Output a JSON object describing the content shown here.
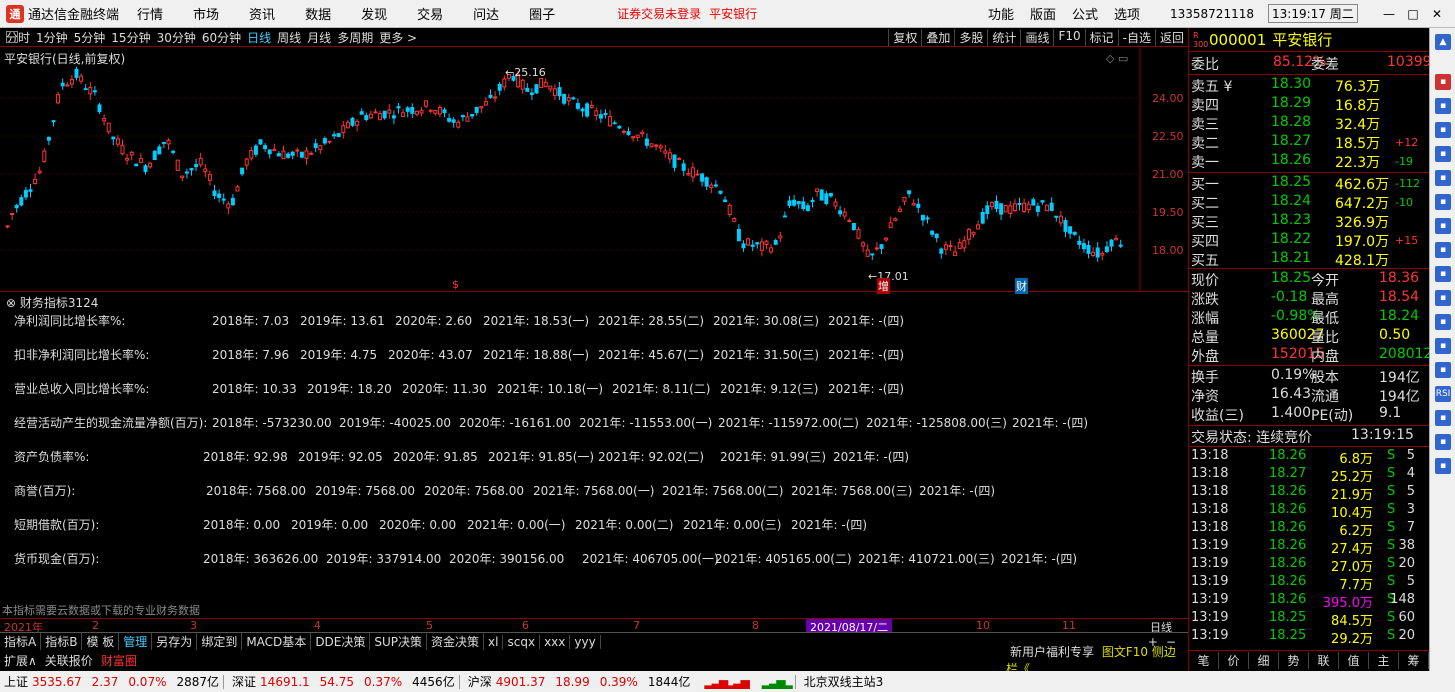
{
  "titlebar": {
    "app_name": "通达信金融终端",
    "menus": [
      "行情",
      "市场",
      "资讯",
      "数据",
      "发现",
      "交易",
      "问达",
      "圈子"
    ],
    "warning": "证券交易未登录",
    "stock_name": "平安银行",
    "right_menus": [
      "功能",
      "版面",
      "公式",
      "选项"
    ],
    "account": "13358721118",
    "clock": "13:19:17 周二",
    "win_buttons": [
      "—",
      "□",
      "✕"
    ]
  },
  "periodbar": {
    "periods": [
      "分时",
      "1分钟",
      "5分钟",
      "15分钟",
      "30分钟",
      "60分钟",
      "日线",
      "周线",
      "月线",
      "多周期",
      "更多 >"
    ],
    "active_index": 6,
    "tools": [
      "复权",
      "叠加",
      "多股",
      "统计",
      "画线",
      "F10",
      "标记",
      "-自选",
      "返回"
    ]
  },
  "chart": {
    "title": "平安银行(日线,前复权)",
    "high_label": "25.16",
    "low_label": "17.01",
    "markers": [
      "$",
      "增",
      "财"
    ],
    "y_ticks": [
      "24.00",
      "22.50",
      "21.00",
      "19.50",
      "18.00"
    ]
  },
  "chart_data": {
    "type": "candlestick",
    "y_ticks": [
      24.0,
      22.5,
      21.0,
      19.5,
      18.0
    ],
    "max": 25.16,
    "min": 17.01,
    "x_ticks": [
      "2021年",
      "2",
      "3",
      "4",
      "5",
      "6",
      "7",
      "8",
      "2021/08/17/二",
      "10",
      "11"
    ],
    "right_label": "日线"
  },
  "finance": {
    "title": "财务指标3124",
    "rows": [
      {
        "label": "净利润同比增长率%:",
        "values": [
          "2018年: 7.03",
          "2019年: 13.61",
          "2020年: 2.60",
          "2021年: 18.53(一)",
          "2021年: 28.55(二)",
          "2021年: 30.08(三)",
          "2021年: -(四)"
        ]
      },
      {
        "label": "扣非净利润同比增长率%:",
        "values": [
          "2018年: 7.96",
          "2019年: 4.75",
          "2020年: 43.07",
          "2021年: 18.88(一)",
          "2021年: 45.67(二)",
          "2021年: 31.50(三)",
          "2021年: -(四)"
        ]
      },
      {
        "label": "营业总收入同比增长率%:",
        "values": [
          "2018年: 10.33",
          "2019年: 18.20",
          "2020年: 11.30",
          "2021年: 10.18(一)",
          "2021年: 8.11(二)",
          "2021年: 9.12(三)",
          "2021年: -(四)"
        ]
      },
      {
        "label": "经营活动产生的现金流量净额(百万):",
        "values": [
          "2018年: -573230.00",
          "2019年: -40025.00",
          "2020年: -16161.00",
          "2021年: -11553.00(一)",
          "2021年: -115972.00(二)",
          "2021年: -125808.00(三)",
          "2021年: -(四)"
        ]
      },
      {
        "label": "资产负债率%:",
        "values": [
          "2018年: 92.98",
          "2019年: 92.05",
          "2020年: 91.85",
          "2021年: 91.85(一)",
          "2021年: 92.02(二)",
          "2021年: 91.99(三)",
          "2021年: -(四)"
        ]
      },
      {
        "label": "商誉(百万):",
        "values": [
          "2018年: 7568.00",
          "2019年: 7568.00",
          "2020年: 7568.00",
          "2021年: 7568.00(一)",
          "2021年: 7568.00(二)",
          "2021年: 7568.00(三)",
          "2021年: -(四)"
        ]
      },
      {
        "label": "短期借款(百万):",
        "values": [
          "2018年: 0.00",
          "2019年: 0.00",
          "2020年: 0.00",
          "2021年: 0.00(一)",
          "2021年: 0.00(二)",
          "2021年: 0.00(三)",
          "2021年: -(四)"
        ]
      },
      {
        "label": "货币现金(百万):",
        "values": [
          "2018年: 363626.00",
          "2019年: 337914.00",
          "2020年: 390156.00",
          "2021年: 406705.00(一)",
          "2021年: 405165.00(二)",
          "2021年: 410721.00(三)",
          "2021年: -(四)"
        ]
      }
    ],
    "note": "本指标需要云数据或下载的专业财务数据"
  },
  "tabs": [
    "指标A",
    "指标B",
    "模 板",
    "管理",
    "另存为",
    "绑定到",
    "MACD基本",
    "DDE决策",
    "SUP决策",
    "资金决策",
    "xl",
    "scqx",
    "xxx",
    "yyy"
  ],
  "tabs_active": 3,
  "tabs_extras": [
    "+",
    "−"
  ],
  "tabs2": [
    "扩展∧",
    "关联报价",
    "财富圈"
  ],
  "promo": "新用户福利专享",
  "promo2": "图文F10 侧边栏《",
  "quote": {
    "badge": "R 300",
    "code": "000001",
    "name": "平安银行",
    "weibi_label": "委比",
    "weibi": "85.12%",
    "weicha_label": "委差",
    "weicha": "10399",
    "sells": [
      {
        "label": "卖五 ¥",
        "price": "18.30",
        "vol": "76.3万",
        "chg": ""
      },
      {
        "label": "卖四",
        "price": "18.29",
        "vol": "16.8万",
        "chg": ""
      },
      {
        "label": "卖三",
        "price": "18.28",
        "vol": "32.4万",
        "chg": ""
      },
      {
        "label": "卖二",
        "price": "18.27",
        "vol": "18.5万",
        "chg": "+12"
      },
      {
        "label": "卖一",
        "price": "18.26",
        "vol": "22.3万",
        "chg": "-19"
      }
    ],
    "buys": [
      {
        "label": "买一",
        "price": "18.25",
        "vol": "462.6万",
        "chg": "-112"
      },
      {
        "label": "买二",
        "price": "18.24",
        "vol": "647.2万",
        "chg": "-10"
      },
      {
        "label": "买三",
        "price": "18.23",
        "vol": "326.9万",
        "chg": ""
      },
      {
        "label": "买四",
        "price": "18.22",
        "vol": "197.0万",
        "chg": "+15"
      },
      {
        "label": "买五",
        "price": "18.21",
        "vol": "428.1万",
        "chg": ""
      }
    ],
    "stats": [
      {
        "l1": "现价",
        "v1": "18.25",
        "l2": "今开",
        "v2": "18.36"
      },
      {
        "l1": "涨跌",
        "v1": "-0.18",
        "l2": "最高",
        "v2": "18.54"
      },
      {
        "l1": "涨幅",
        "v1": "-0.98%",
        "l2": "最低",
        "v2": "18.24"
      },
      {
        "l1": "总量",
        "v1": "360027",
        "l2": "量比",
        "v2": "0.50"
      },
      {
        "l1": "外盘",
        "v1": "152015",
        "l2": "内盘",
        "v2": "208012"
      }
    ],
    "stats2": [
      {
        "l1": "换手",
        "v1": "0.19%",
        "l2": "股本",
        "v2": "194亿"
      },
      {
        "l1": "净资",
        "v1": "16.43",
        "l2": "流通",
        "v2": "194亿"
      },
      {
        "l1": "收益(三)",
        "v1": "1.400",
        "l2": "PE(动)",
        "v2": "9.1"
      }
    ],
    "trade_state_label": "交易状态: 连续竞价",
    "trade_state_time": "13:19:15",
    "ticks": [
      {
        "t": "13:18",
        "p": "18.26",
        "v": "6.8万",
        "s": "S",
        "n": "5"
      },
      {
        "t": "13:18",
        "p": "18.27",
        "v": "25.2万",
        "s": "S",
        "n": "4"
      },
      {
        "t": "13:18",
        "p": "18.26",
        "v": "21.9万",
        "s": "S",
        "n": "5"
      },
      {
        "t": "13:18",
        "p": "18.26",
        "v": "10.4万",
        "s": "S",
        "n": "3"
      },
      {
        "t": "13:18",
        "p": "18.26",
        "v": "6.2万",
        "s": "S",
        "n": "7"
      },
      {
        "t": "13:19",
        "p": "18.26",
        "v": "27.4万",
        "s": "S",
        "n": "38"
      },
      {
        "t": "13:19",
        "p": "18.26",
        "v": "27.0万",
        "s": "S",
        "n": "20"
      },
      {
        "t": "13:19",
        "p": "18.26",
        "v": "7.7万",
        "s": "S",
        "n": "5"
      },
      {
        "t": "13:19",
        "p": "18.26",
        "v": "395.0万",
        "s": "S",
        "n": "148"
      },
      {
        "t": "13:19",
        "p": "18.25",
        "v": "84.5万",
        "s": "S",
        "n": "60"
      },
      {
        "t": "13:19",
        "p": "18.25",
        "v": "29.2万",
        "s": "S",
        "n": "20"
      }
    ],
    "bottom_tabs": [
      "笔",
      "价",
      "细",
      "势",
      "联",
      "值",
      "主",
      "筹"
    ]
  },
  "statusbar": {
    "sh_label": "上证",
    "sh_val": "3535.67",
    "sh_chg": "2.37",
    "sh_pct": "0.07%",
    "sh_amt": "2887亿",
    "sz_label": "深证",
    "sz_val": "14691.1",
    "sz_chg": "54.75",
    "sz_pct": "0.37%",
    "sz_amt": "4456亿",
    "hs_label": "沪深",
    "hs_val": "4901.37",
    "hs_chg": "18.99",
    "hs_pct": "0.39%",
    "hs_amt": "1844亿",
    "server": "北京双线主站3"
  }
}
